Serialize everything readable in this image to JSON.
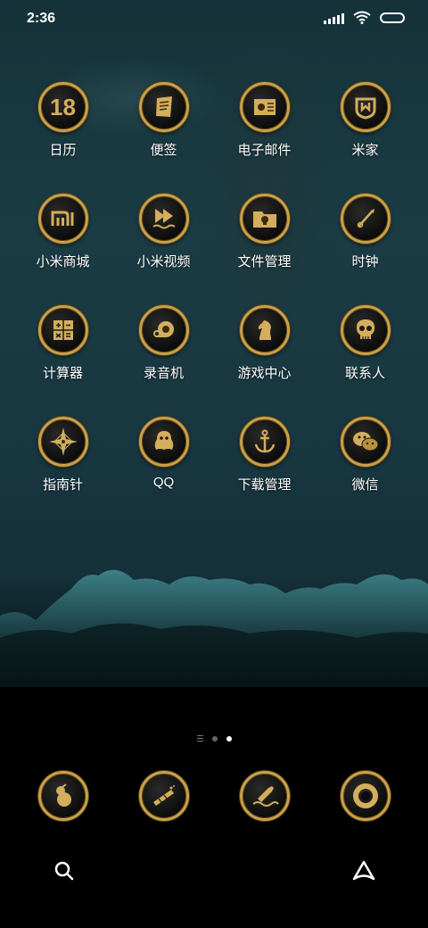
{
  "status_bar": {
    "time": "2:36"
  },
  "apps": [
    {
      "name": "calendar",
      "label": "日历",
      "glyph": "18",
      "icon": "calendar-icon"
    },
    {
      "name": "notes",
      "label": "便签",
      "glyph": "",
      "icon": "scroll-icon"
    },
    {
      "name": "email",
      "label": "电子邮件",
      "glyph": "",
      "icon": "letter-icon"
    },
    {
      "name": "mijia",
      "label": "米家",
      "glyph": "",
      "icon": "mijia-icon"
    },
    {
      "name": "mi-store",
      "label": "小米商城",
      "glyph": "",
      "icon": "mi-logo-icon"
    },
    {
      "name": "mi-video",
      "label": "小米视频",
      "glyph": "",
      "icon": "play-icon"
    },
    {
      "name": "file-manager",
      "label": "文件管理",
      "glyph": "",
      "icon": "folder-skull-icon"
    },
    {
      "name": "clock",
      "label": "时钟",
      "glyph": "",
      "icon": "clock-hand-icon"
    },
    {
      "name": "calculator",
      "label": "计算器",
      "glyph": "",
      "icon": "calculator-icon"
    },
    {
      "name": "recorder",
      "label": "录音机",
      "glyph": "",
      "icon": "tape-icon"
    },
    {
      "name": "game-center",
      "label": "游戏中心",
      "glyph": "",
      "icon": "chess-knight-icon"
    },
    {
      "name": "contacts",
      "label": "联系人",
      "glyph": "",
      "icon": "skull-icon"
    },
    {
      "name": "compass",
      "label": "指南针",
      "glyph": "",
      "icon": "compass-rose-icon"
    },
    {
      "name": "qq",
      "label": "QQ",
      "glyph": "",
      "icon": "qq-penguin-icon"
    },
    {
      "name": "downloads",
      "label": "下载管理",
      "glyph": "",
      "icon": "anchor-icon"
    },
    {
      "name": "wechat",
      "label": "微信",
      "glyph": "",
      "icon": "wechat-icon"
    }
  ],
  "dock": [
    {
      "name": "phone",
      "icon": "gourd-phone-icon"
    },
    {
      "name": "messages",
      "icon": "spyglass-icon"
    },
    {
      "name": "browser",
      "icon": "bottle-wave-icon"
    },
    {
      "name": "camera",
      "icon": "lens-ring-icon"
    }
  ],
  "page_indicator": {
    "pages": 2,
    "active": 2
  },
  "colors": {
    "gold": "#c9a14a",
    "sea_top": "#163239",
    "sea_bottom": "#000000"
  }
}
